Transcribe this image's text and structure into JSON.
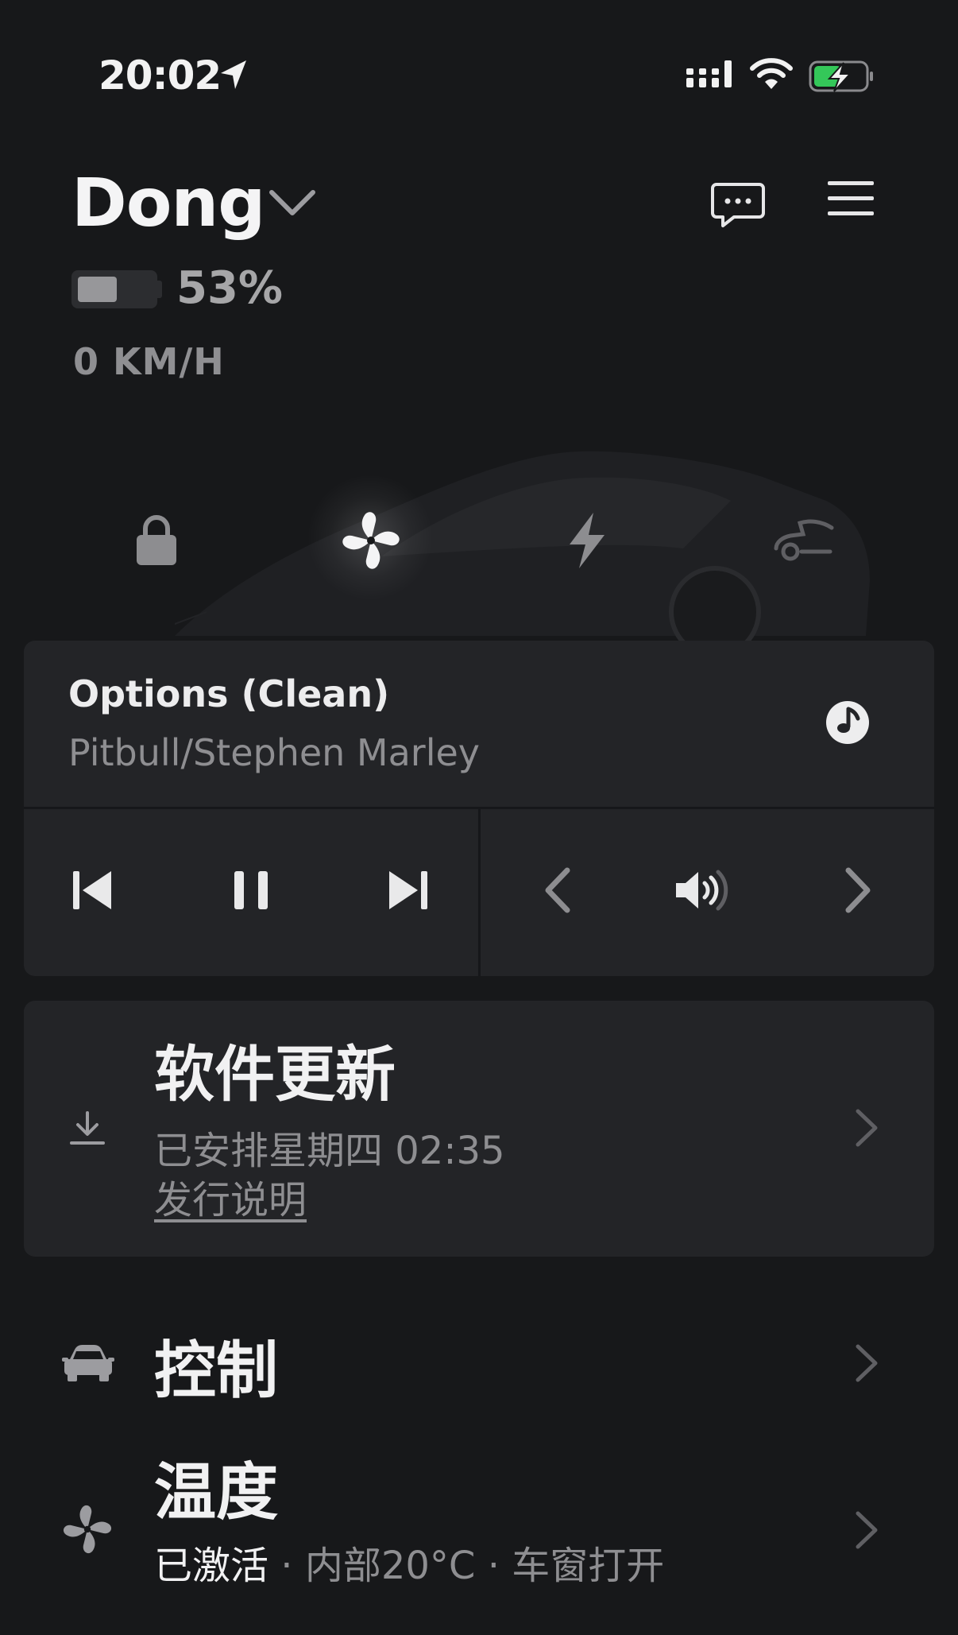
{
  "status_bar": {
    "time": "20:02",
    "icons": [
      "location-arrow-icon",
      "cellular-signal-icon",
      "wifi-icon",
      "charging-battery-icon"
    ],
    "battery_accent": "#34c759"
  },
  "header": {
    "vehicle_name": "Dong",
    "battery_percent": "53%",
    "battery_level": 0.53,
    "speed": "0 KM/H",
    "icons": [
      "chevron-down-icon",
      "chat-bubble-icon",
      "hamburger-menu-icon"
    ]
  },
  "quick_actions": [
    {
      "name": "lock",
      "icon": "lock-icon"
    },
    {
      "name": "climate",
      "icon": "fan-icon",
      "active": true
    },
    {
      "name": "charge",
      "icon": "lightning-icon"
    },
    {
      "name": "frunk",
      "icon": "frunk-icon"
    }
  ],
  "media": {
    "title": "Options (Clean)",
    "artist": "Pitbull/Stephen Marley",
    "source_icon": "music-source-icon",
    "controls": [
      "previous-track-icon",
      "pause-icon",
      "next-track-icon",
      "chevron-left-icon",
      "volume-icon",
      "chevron-right-icon"
    ]
  },
  "software_update": {
    "title": "软件更新",
    "schedule": "已安排星期四 02:35",
    "release_notes": "发行说明",
    "icon": "download-icon"
  },
  "controls_row": {
    "title": "控制",
    "icon": "car-icon"
  },
  "climate_row": {
    "title": "温度",
    "status_active": "已激活",
    "separator": "·",
    "status_inside": "内部20°C",
    "status_windows": "车窗打开",
    "icon": "fan-icon"
  },
  "colors": {
    "background": "#17181a",
    "card": "#232427",
    "primary_text": "#f1f1f2",
    "secondary_text": "#8e8e91"
  }
}
